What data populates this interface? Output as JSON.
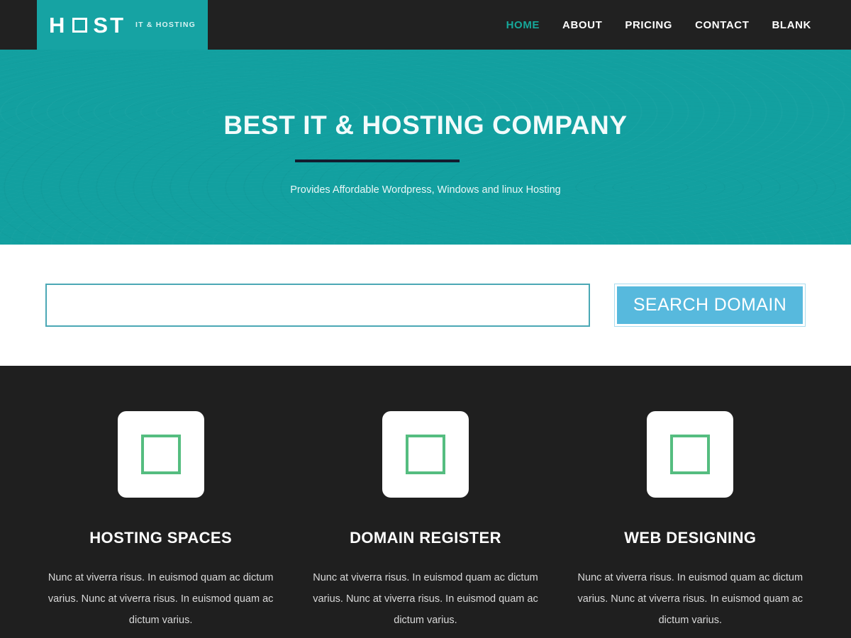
{
  "header": {
    "logo": {
      "part1": "H",
      "icon": "square-outline-icon",
      "part2": "ST",
      "tagline": "IT & HOSTING"
    },
    "nav": [
      {
        "label": "HOME",
        "active": true
      },
      {
        "label": "ABOUT",
        "active": false
      },
      {
        "label": "PRICING",
        "active": false
      },
      {
        "label": "CONTACT",
        "active": false
      },
      {
        "label": "BLANK",
        "active": false
      }
    ]
  },
  "hero": {
    "title": "BEST IT & HOSTING COMPANY",
    "subtitle": "Provides Affordable Wordpress, Windows and linux Hosting"
  },
  "search": {
    "value": "",
    "placeholder": "",
    "button_label": "SEARCH DOMAIN"
  },
  "features": [
    {
      "icon": "square-outline-icon",
      "title": "HOSTING SPACES",
      "text": "Nunc at viverra risus. In euismod quam ac dictum varius. Nunc at viverra risus. In euismod quam ac dictum varius."
    },
    {
      "icon": "square-outline-icon",
      "title": "DOMAIN REGISTER",
      "text": "Nunc at viverra risus. In euismod quam ac dictum varius. Nunc at viverra risus. In euismod quam ac dictum varius."
    },
    {
      "icon": "square-outline-icon",
      "title": "WEB DESIGNING",
      "text": "Nunc at viverra risus. In euismod quam ac dictum varius. Nunc at viverra risus. In euismod quam ac dictum varius."
    }
  ],
  "colors": {
    "header_bg": "#212121",
    "logo_bg": "#16a3a3",
    "hero_bg": "#12a0a0",
    "accent_teal": "#16a89a",
    "input_border": "#4ba8b5",
    "button_bg": "#57b9dd",
    "icon_green": "#55bd80",
    "section_dark": "#1f1f1f"
  }
}
